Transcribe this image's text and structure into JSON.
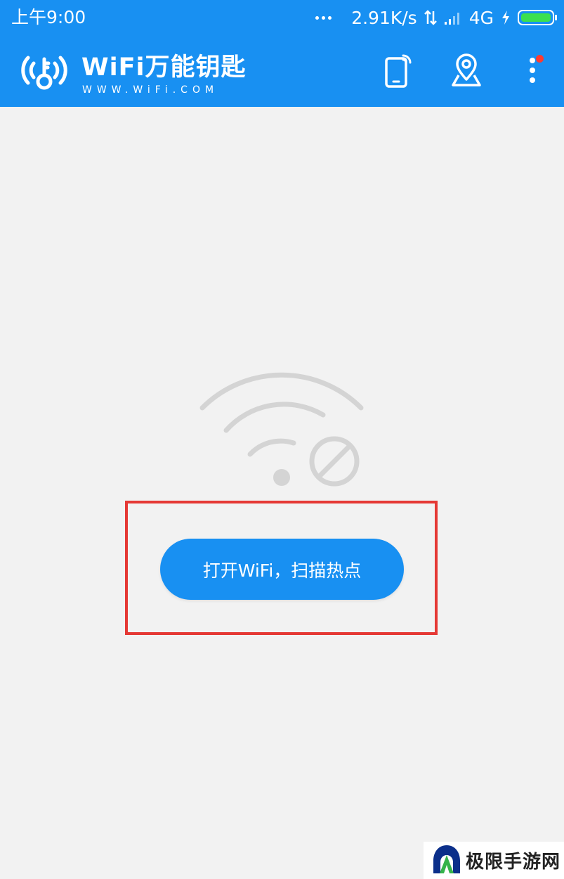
{
  "status_bar": {
    "time": "上午9:00",
    "net_speed": "2.91K/s",
    "network_type": "4G",
    "icons": [
      "more-dots-icon",
      "data-arrows-icon",
      "signal-icon",
      "charging-icon",
      "battery-icon"
    ]
  },
  "app_bar": {
    "title": "WiFi万能钥匙",
    "subtitle": "WWW.WiFi.COM",
    "actions": [
      "phone-connect-icon",
      "map-location-icon",
      "more-menu-icon"
    ],
    "has_notification_dot": true
  },
  "main": {
    "illustration": "wifi-disabled-icon",
    "open_wifi_button_label": "打开WiFi，扫描热点"
  },
  "watermark": {
    "text": "极限手游网"
  },
  "colors": {
    "primary": "#1890f2",
    "background": "#f2f2f2",
    "highlight": "#e53935",
    "illustration": "#d4d4d4",
    "battery": "#3be04f",
    "notification": "#ff3b30"
  }
}
